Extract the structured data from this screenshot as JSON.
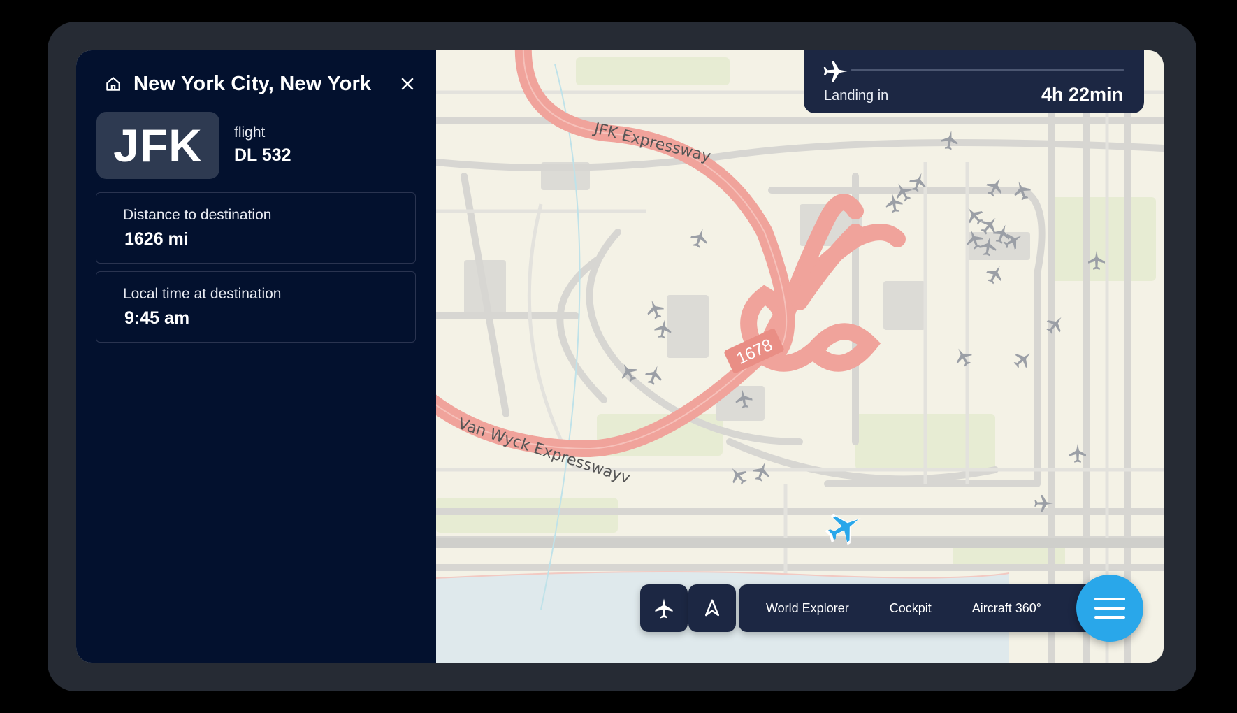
{
  "panel": {
    "title": "New York City, New York",
    "airport_code": "JFK",
    "flight_label": "flight",
    "flight_number": "DL 532",
    "cards": [
      {
        "label": "Distance to destination",
        "value": "1626 mi"
      },
      {
        "label": "Local time at destination",
        "value": "9:45 am"
      }
    ],
    "icons": {
      "home": "home-icon",
      "close": "close-icon"
    }
  },
  "landing": {
    "label": "Landing in",
    "time": "4h 22min",
    "progress": 0,
    "icon": "airplane-icon"
  },
  "map": {
    "road_labels": [
      "JFK Expressway",
      "Van Wyck Expresswayv",
      "1678"
    ]
  },
  "bottom_bar": {
    "buttons": [
      {
        "icon": "airplane-icon",
        "name": "flight-mode-button"
      },
      {
        "icon": "navigation-arrow-icon",
        "name": "navigation-button"
      }
    ],
    "nav_items": [
      "World Explorer",
      "Cockpit",
      "Aircraft 360°"
    ],
    "menu_icon": "hamburger-menu-icon"
  },
  "colors": {
    "panel_bg": "#03112e",
    "accent": "#29a7ea",
    "bar_bg": "#1c2743",
    "road": "#f0a39b",
    "map_bg": "#f4f2e6"
  }
}
